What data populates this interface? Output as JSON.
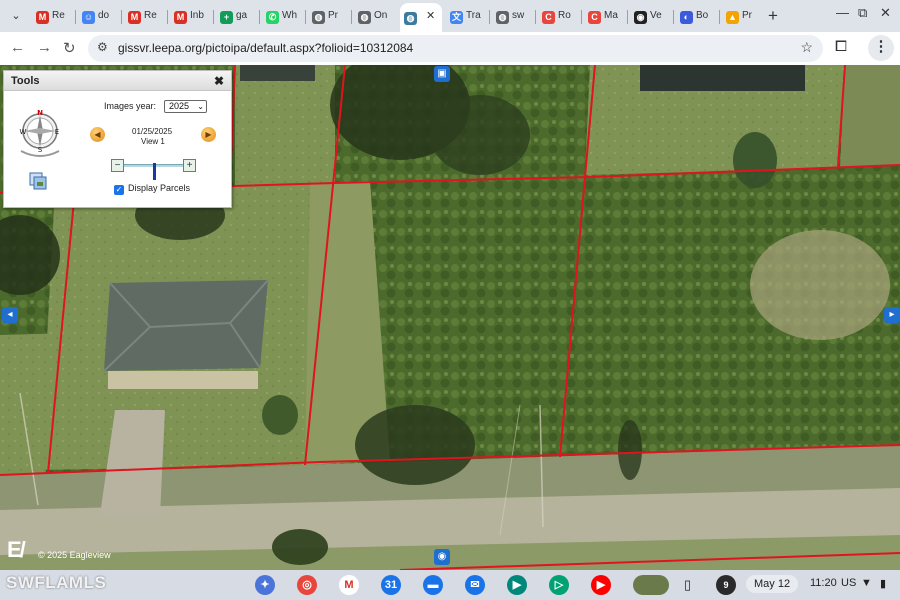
{
  "browser": {
    "tabs": [
      {
        "label": "Re",
        "favicon": "gmail-icon",
        "color": "#d93025",
        "glyph": "M"
      },
      {
        "label": "do",
        "favicon": "smile-icon",
        "color": "#4285f4",
        "glyph": "☺"
      },
      {
        "label": "Re",
        "favicon": "gmail-icon",
        "color": "#d93025",
        "glyph": "M"
      },
      {
        "label": "Inb",
        "favicon": "gmail-icon",
        "color": "#d93025",
        "glyph": "M"
      },
      {
        "label": "ga",
        "favicon": "sheets-plus-icon",
        "color": "#0f9d58",
        "glyph": "+"
      },
      {
        "label": "Wh",
        "favicon": "whatsapp-icon",
        "color": "#25d366",
        "glyph": "✆"
      },
      {
        "label": "Pr",
        "favicon": "globe-icon",
        "color": "#5f6368",
        "glyph": "◍"
      },
      {
        "label": "On",
        "favicon": "globe-icon",
        "color": "#5f6368",
        "glyph": "◍"
      },
      {
        "label": "",
        "favicon": "globe-icon",
        "color": "#3c7a9e",
        "glyph": "◍",
        "active": true
      },
      {
        "label": "Tra",
        "favicon": "translate-icon",
        "color": "#4285f4",
        "glyph": "文"
      },
      {
        "label": "sw",
        "favicon": "globe-icon",
        "color": "#5f6368",
        "glyph": "◍"
      },
      {
        "label": "Ro",
        "favicon": "c-icon",
        "color": "#e8453c",
        "glyph": "C"
      },
      {
        "label": "Ma",
        "favicon": "c-icon",
        "color": "#e8453c",
        "glyph": "C"
      },
      {
        "label": "Ve",
        "favicon": "eye-icon",
        "color": "#222222",
        "glyph": "◉"
      },
      {
        "label": "Bo",
        "favicon": "swirl-icon",
        "color": "#3b5bdb",
        "glyph": "◐"
      },
      {
        "label": "Pr",
        "favicon": "cone-icon",
        "color": "#f4a300",
        "glyph": "▲"
      }
    ],
    "url": "gissvr.leepa.org/pictoipa/default.aspx?folioid=10312084"
  },
  "tools_panel": {
    "title": "Tools",
    "images_year_label": "Images year:",
    "images_year_value": "2025",
    "image_date": "01/25/2025",
    "image_view": "View 1",
    "display_parcels_label": "Display Parcels",
    "display_parcels_checked": true,
    "zoom_level": 0.5,
    "compass_letters": [
      "N",
      "E",
      "S",
      "W"
    ]
  },
  "map": {
    "copyright": "© 2025 Eagleview",
    "logo": "E/",
    "parcel_line_color": "#e0141e"
  },
  "shelf": {
    "apps": [
      {
        "name": "gemini-icon",
        "color": "#4a74d9"
      },
      {
        "name": "chrome-icon",
        "color": "#e8453c"
      },
      {
        "name": "gmail-icon",
        "color": "#ffffff"
      },
      {
        "name": "calendar-icon",
        "color": "#1a73e8"
      },
      {
        "name": "files-icon",
        "color": "#1a73e8"
      },
      {
        "name": "messages-icon",
        "color": "#1a73e8"
      },
      {
        "name": "meet-icon",
        "color": "#00897b"
      },
      {
        "name": "play-store-icon",
        "color": "#00a173"
      },
      {
        "name": "youtube-icon",
        "color": "#ff0000"
      }
    ],
    "notification_count": "9",
    "date": "May 12",
    "time": "11:20",
    "locale": "US",
    "watermark": "SWFLAMLS"
  }
}
